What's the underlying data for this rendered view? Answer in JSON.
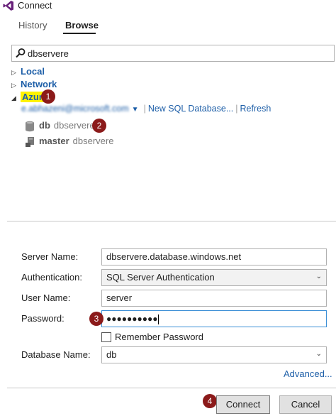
{
  "window": {
    "title": "Connect"
  },
  "tabs": [
    {
      "label": "History"
    },
    {
      "label": "Browse"
    }
  ],
  "search": {
    "value": "dbservere"
  },
  "tree": {
    "local": "Local",
    "network": "Network",
    "azure": "Azure",
    "account_email": "e.abhazeni@microsoft.com",
    "new_sql_db": "New SQL Database...",
    "refresh": "Refresh",
    "databases": [
      {
        "name": "db",
        "server": "dbservere"
      },
      {
        "name": "master",
        "server": "dbservere"
      }
    ]
  },
  "badges": [
    "1",
    "2",
    "3",
    "4"
  ],
  "form": {
    "server_name_label": "Server Name:",
    "server_name_value": "dbservere.database.windows.net",
    "auth_label": "Authentication:",
    "auth_value": "SQL Server Authentication",
    "user_label": "User Name:",
    "user_value": "server",
    "password_label": "Password:",
    "password_value": "●●●●●●●●●●",
    "remember_label": "Remember Password",
    "remember_checked": false,
    "db_label": "Database Name:",
    "db_value": "db",
    "advanced": "Advanced..."
  },
  "buttons": {
    "connect": "Connect",
    "cancel": "Cancel"
  },
  "colors": {
    "badge": "#8b1a1a",
    "link": "#1e5fa8",
    "highlight": "#fff200"
  }
}
